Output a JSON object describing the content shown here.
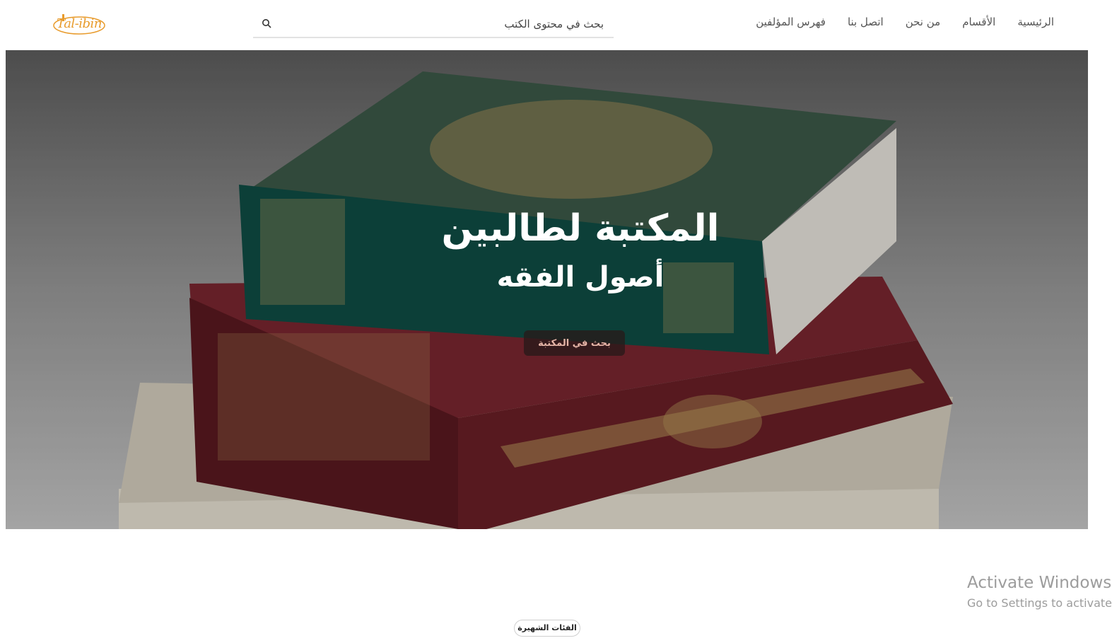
{
  "header": {
    "logo_text": "Tal-ibin",
    "search_placeholder": "بحث في محتوى الكتب",
    "nav": [
      "فهرس المؤلفين",
      "اتصل بنا",
      "من نحن",
      "الأقسام",
      "الرئيسية"
    ]
  },
  "hero": {
    "title": "المكتبة لطالبين",
    "subtitle": "أصول الفقه",
    "button_label": "بحث في المكتبة"
  },
  "section": {
    "popular_label": "الفئات الشهيرة"
  },
  "watermark": {
    "line1": "Activate Windows",
    "line2": "Go to Settings to activate"
  },
  "colors": {
    "logo": "#e89b2c",
    "book_green": "#0f4e45",
    "book_red": "#6b1f26",
    "gold": "#b99a5c"
  }
}
